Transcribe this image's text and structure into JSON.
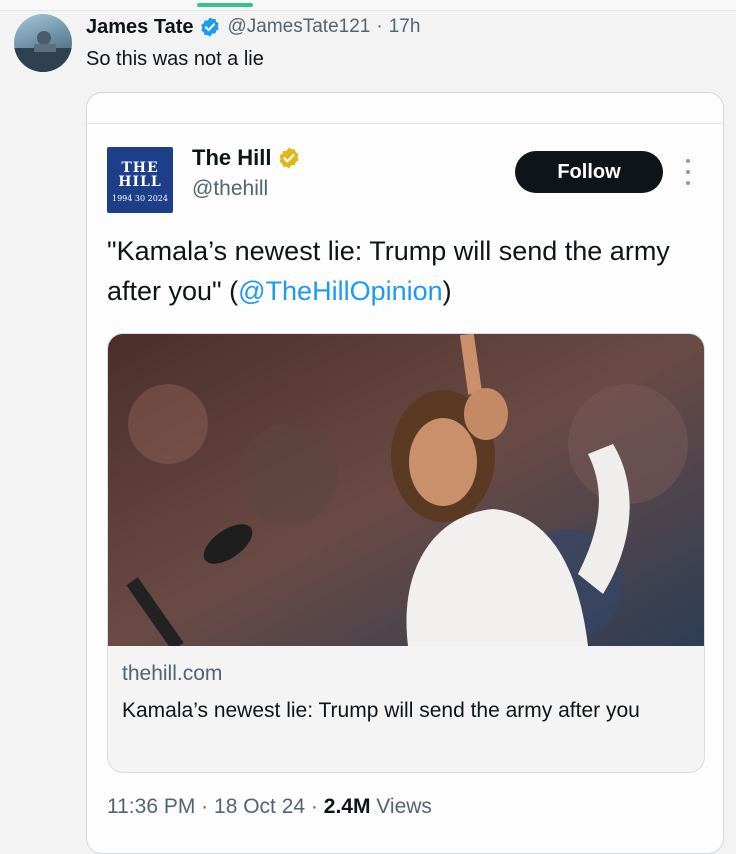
{
  "tweet": {
    "author_name": "James Tate",
    "author_handle": "@JamesTate121",
    "separator": "·",
    "time_ago": "17h",
    "text": "So this was not a lie"
  },
  "quoted": {
    "author_name": "The Hill",
    "author_handle": "@thehill",
    "logo": {
      "line1": "THE",
      "line2": "HILL",
      "tagline": "1994 30 2024"
    },
    "follow_label": "Follow",
    "text_main": "\"Kamala’s newest lie: Trump will send the army after you\" (",
    "mention": "@TheHillOpinion",
    "text_end": ")",
    "link_card": {
      "domain": "thehill.com",
      "title": "Kamala’s newest lie: Trump will send the army after you"
    },
    "meta": {
      "time": "11:36 PM",
      "sep1": "·",
      "date": "18 Oct 24",
      "sep2": "·",
      "views_count": "2.4M",
      "views_label": "Views"
    }
  },
  "icons": [
    "verified-badge-icon",
    "gold-verified-badge-icon",
    "more-options-icon"
  ],
  "colors": {
    "accent": "#1d9bf0",
    "verified_gold": "#e2b719",
    "follow_bg": "#0f1419",
    "muted_text": "#536471",
    "logo_blue": "#1d3f8a"
  }
}
